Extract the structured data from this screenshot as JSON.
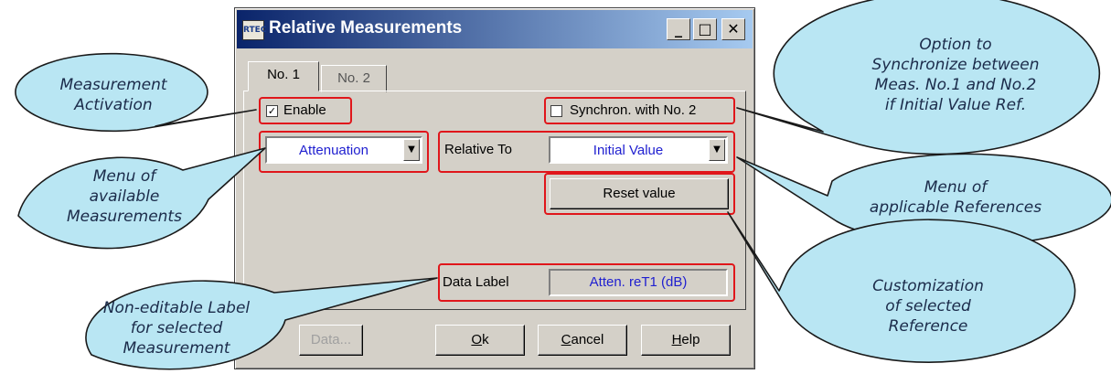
{
  "window": {
    "title": "Relative Measurements",
    "icon_text": "RTEC",
    "minimize_glyph": "_",
    "maximize_glyph": "□",
    "close_glyph": "✕"
  },
  "tabs": [
    {
      "label": "No. 1",
      "active": true
    },
    {
      "label": "No. 2",
      "active": false
    }
  ],
  "enable": {
    "label": "Enable",
    "checked": true,
    "mark": "✓"
  },
  "synchron": {
    "label": "Synchron. with No. 2",
    "checked": false
  },
  "measurement_select": {
    "value": "Attenuation"
  },
  "relative_to": {
    "label": "Relative To",
    "value": "Initial Value"
  },
  "reset_button": "Reset value",
  "data_label": {
    "label": "Data Label",
    "value": "Atten. reT1 (dB)"
  },
  "buttons": {
    "data": "Data...",
    "ok_prefix": "O",
    "ok_rest": "k",
    "cancel_prefix": "C",
    "cancel_rest": "ancel",
    "help_prefix": "H",
    "help_rest": "elp"
  },
  "colors": {
    "highlight": "#e0161b",
    "callout_fill": "#b9e6f3",
    "value_text": "#2020d0"
  },
  "callouts": {
    "activation": [
      "Measurement",
      "Activation"
    ],
    "menu_measurements": [
      "Menu of",
      "available",
      "Measurements"
    ],
    "label": [
      "Non-editable Label",
      "for selected",
      "Measurement"
    ],
    "synchronize": [
      "Option to",
      "Synchronize between",
      "Meas. No.1 and No.2",
      "if Initial Value Ref."
    ],
    "references": [
      "Menu of",
      "applicable References"
    ],
    "customization": [
      "Customization",
      "of selected",
      "Reference"
    ]
  }
}
